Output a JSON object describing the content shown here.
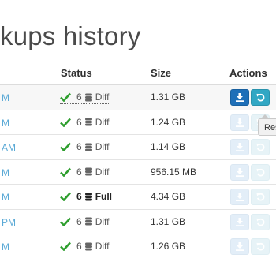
{
  "page": {
    "title": "kups history"
  },
  "table": {
    "headers": {
      "status": "Status",
      "size": "Size",
      "actions": "Actions"
    },
    "rows": [
      {
        "date": "M",
        "count": "6",
        "type": "Diff",
        "size": "1.31 GB",
        "enabled": true
      },
      {
        "date": "M",
        "count": "6",
        "type": "Diff",
        "size": "1.24 GB",
        "enabled": false
      },
      {
        "date": "AM",
        "count": "6",
        "type": "Diff",
        "size": "1.14 GB",
        "enabled": false
      },
      {
        "date": "M",
        "count": "6",
        "type": "Diff",
        "size": "956.15 MB",
        "enabled": false
      },
      {
        "date": "M",
        "count": "6",
        "type": "Full",
        "size": "4.34 GB",
        "enabled": false
      },
      {
        "date": "PM",
        "count": "6",
        "type": "Diff",
        "size": "1.31 GB",
        "enabled": false
      },
      {
        "date": "M",
        "count": "6",
        "type": "Diff",
        "size": "1.26 GB",
        "enabled": false
      }
    ]
  },
  "tooltip": {
    "text": "Res"
  },
  "icons": {
    "status_ok": "check-icon",
    "backup_db": "database-icon",
    "download": "download-icon",
    "restore": "restore-icon"
  },
  "colors": {
    "check": "#2e9e2e",
    "link": "#5aa9d6",
    "download_btn": "#1e6fb8",
    "restore_btn": "#31a7c4"
  }
}
